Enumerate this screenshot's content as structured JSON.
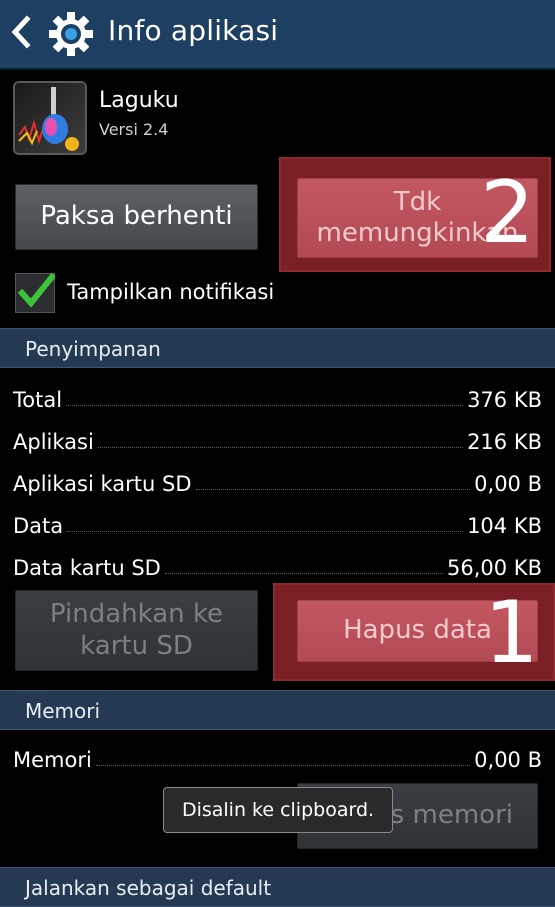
{
  "header": {
    "title": "Info aplikasi"
  },
  "app": {
    "name": "Laguku",
    "version": "Versi 2.4"
  },
  "buttons": {
    "force_stop": "Paksa berhenti",
    "disable_line1": "Tdk",
    "disable_line2": "memungkinkan",
    "move_line1": "Pindahkan ke",
    "move_line2": "kartu SD",
    "clear_data": "Hapus data",
    "clear_cache": "Hapus memori"
  },
  "annotations": {
    "first": "1",
    "second": "2"
  },
  "notifications": {
    "label": "Tampilkan notifikasi",
    "checked": true
  },
  "storage": {
    "title": "Penyimpanan",
    "rows": [
      {
        "label": "Total",
        "value": "376 KB"
      },
      {
        "label": "Aplikasi",
        "value": "216 KB"
      },
      {
        "label": "Aplikasi kartu SD",
        "value": "0,00 B"
      },
      {
        "label": "Data",
        "value": "104 KB"
      },
      {
        "label": "Data kartu SD",
        "value": "56,00 KB"
      }
    ]
  },
  "memory": {
    "title": "Memori",
    "rows": [
      {
        "label": "Memori",
        "value": "0,00 B"
      }
    ]
  },
  "toast": "Disalin ke clipboard.",
  "launch_default": {
    "title": "Jalankan sebagai default"
  },
  "colors": {
    "actionbar": "#1d3f62",
    "section": "#243a52",
    "highlight": "#7a1f24",
    "check": "#3bc43a"
  }
}
